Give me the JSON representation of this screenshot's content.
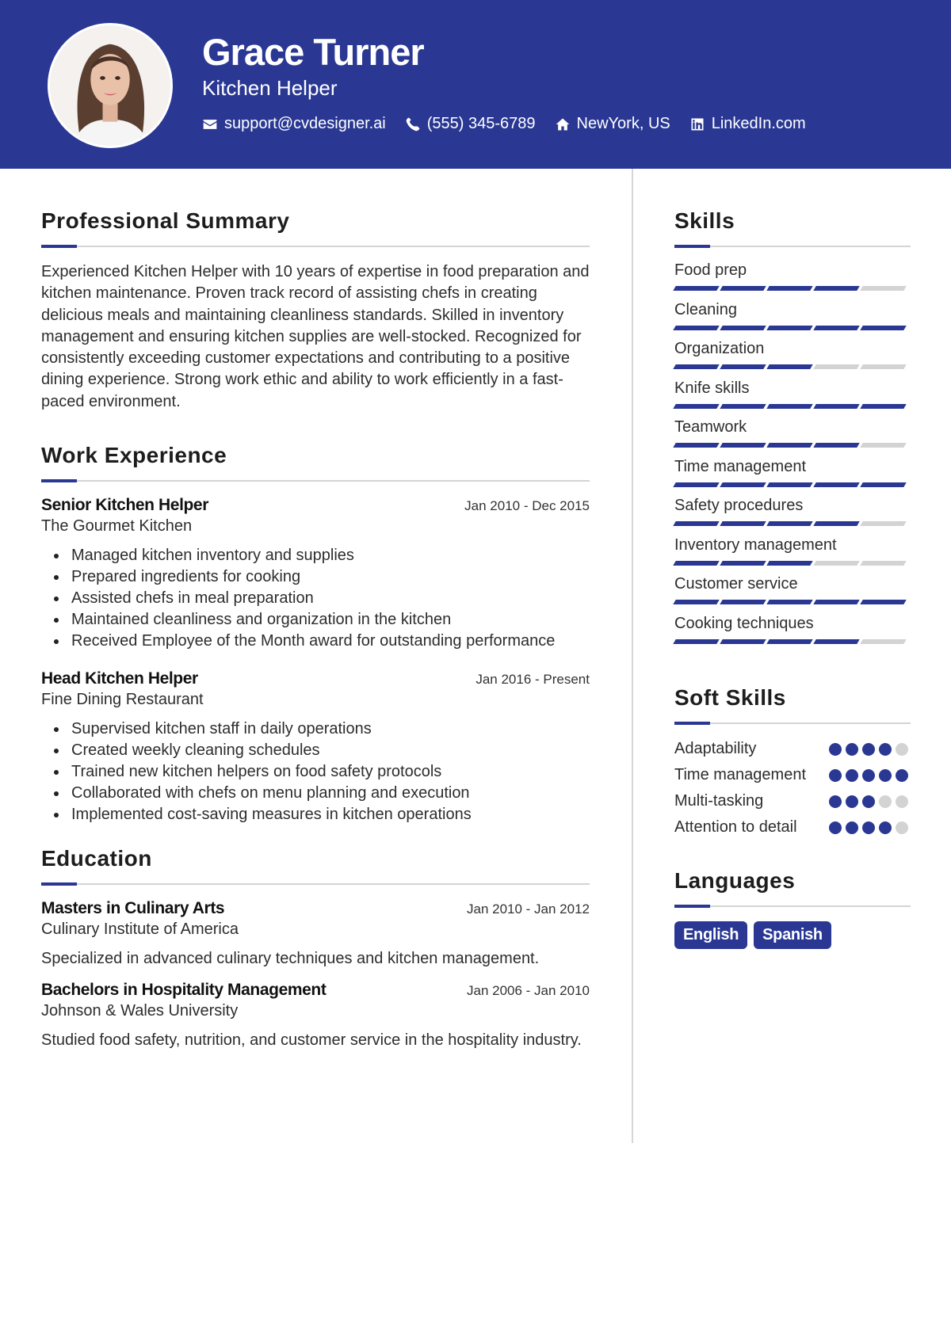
{
  "header": {
    "name": "Grace Turner",
    "title": "Kitchen Helper",
    "contacts": [
      {
        "icon": "envelope-icon",
        "text": "support@cvdesigner.ai"
      },
      {
        "icon": "phone-icon",
        "text": "(555) 345-6789"
      },
      {
        "icon": "home-icon",
        "text": "NewYork, US"
      },
      {
        "icon": "linkedin-icon",
        "text": "LinkedIn.com"
      }
    ]
  },
  "colors": {
    "accent": "#2a3894",
    "inactive": "#d3d3d3"
  },
  "summary": {
    "heading": "Professional Summary",
    "text": "Experienced Kitchen Helper with 10 years of expertise in food preparation and kitchen maintenance. Proven track record of assisting chefs in creating delicious meals and maintaining cleanliness standards. Skilled in inventory management and ensuring kitchen supplies are well-stocked. Recognized for consistently exceeding customer expectations and contributing to a positive dining experience. Strong work ethic and ability to work efficiently in a fast-paced environment."
  },
  "experience": {
    "heading": "Work Experience",
    "jobs": [
      {
        "role": "Senior Kitchen Helper",
        "dates": "Jan 2010 - Dec 2015",
        "org": "The Gourmet Kitchen",
        "bullets": [
          "Managed kitchen inventory and supplies",
          "Prepared ingredients for cooking",
          "Assisted chefs in meal preparation",
          "Maintained cleanliness and organization in the kitchen",
          "Received Employee of the Month award for outstanding performance"
        ]
      },
      {
        "role": "Head Kitchen Helper",
        "dates": "Jan 2016 - Present",
        "org": "Fine Dining Restaurant",
        "bullets": [
          "Supervised kitchen staff in daily operations",
          "Created weekly cleaning schedules",
          "Trained new kitchen helpers on food safety protocols",
          "Collaborated with chefs on menu planning and execution",
          "Implemented cost-saving measures in kitchen operations"
        ]
      }
    ]
  },
  "education": {
    "heading": "Education",
    "items": [
      {
        "degree": "Masters in Culinary Arts",
        "dates": "Jan 2010 - Jan 2012",
        "school": "Culinary Institute of America",
        "desc": "Specialized in advanced culinary techniques and kitchen management."
      },
      {
        "degree": "Bachelors in Hospitality Management",
        "dates": "Jan 2006 - Jan 2010",
        "school": "Johnson & Wales University",
        "desc": "Studied food safety, nutrition, and customer service in the hospitality industry."
      }
    ]
  },
  "skills": {
    "heading": "Skills",
    "max": 5,
    "items": [
      {
        "name": "Food prep",
        "level": 4
      },
      {
        "name": "Cleaning",
        "level": 5
      },
      {
        "name": "Organization",
        "level": 3
      },
      {
        "name": "Knife skills",
        "level": 5
      },
      {
        "name": "Teamwork",
        "level": 4
      },
      {
        "name": "Time management",
        "level": 5
      },
      {
        "name": "Safety procedures",
        "level": 4
      },
      {
        "name": "Inventory management",
        "level": 3
      },
      {
        "name": "Customer service",
        "level": 5
      },
      {
        "name": "Cooking techniques",
        "level": 4
      }
    ]
  },
  "soft_skills": {
    "heading": "Soft Skills",
    "max": 5,
    "items": [
      {
        "name": "Adaptability",
        "level": 4
      },
      {
        "name": "Time management",
        "level": 5
      },
      {
        "name": "Multi-tasking",
        "level": 3
      },
      {
        "name": "Attention to detail",
        "level": 4
      }
    ]
  },
  "languages": {
    "heading": "Languages",
    "items": [
      "English",
      "Spanish"
    ]
  }
}
